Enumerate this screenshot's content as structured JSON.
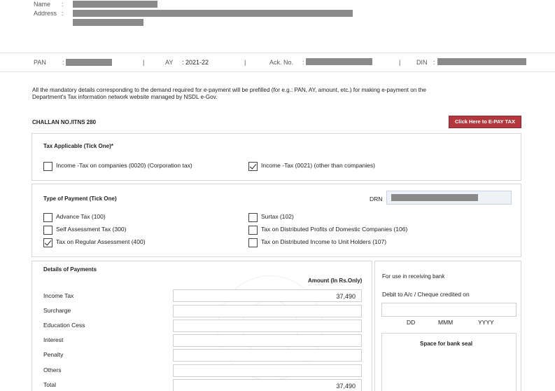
{
  "header": {
    "name_label": "Name",
    "address_label": "Address",
    "colon": ":"
  },
  "panbar": {
    "pan_label": "PAN",
    "ay_label": "AY",
    "ay_value": ": 2021-22",
    "ack_label": "Ack. No.",
    "din_label": "DIN",
    "separator": "|"
  },
  "intro": {
    "line1": "All the mandatory details corresponding to the demand required for e-payment will be prefilled (for e.g.: PAN, AY, amount, etc.) for making e-payment on the",
    "line2": "Department's Tax information network website managed by NSDL e-Gov."
  },
  "challan": {
    "title": "CHALLAN NO./ITNS 280",
    "pay_button": "Click Here to E-PAY TAX"
  },
  "tax_applicable": {
    "title": "Tax Applicable (Tick One)*",
    "options": [
      {
        "label": "Income -Tax on companies (0020) (Corporation tax)",
        "checked": false
      },
      {
        "label": "Income -Tax (0021) (other than companies)",
        "checked": true
      }
    ]
  },
  "payment_type": {
    "title": "Type of Payment (Tick One)",
    "drn_label": "DRN",
    "options": [
      {
        "label": "Advance Tax (100)",
        "checked": false
      },
      {
        "label": "Surtax (102)",
        "checked": false
      },
      {
        "label": "Self Assessment Tax (300)",
        "checked": false
      },
      {
        "label": "Tax on Distributed Profits of Domestic Companies (106)",
        "checked": false
      },
      {
        "label": "Tax on Regular Assessment (400)",
        "checked": true
      },
      {
        "label": "Tax on Distributed Income to Unit Holders (107)",
        "checked": false
      }
    ]
  },
  "details": {
    "title": "Details of Payments",
    "amount_header": "Amount (In Rs.Only)",
    "rows": [
      {
        "label": "Income Tax",
        "amount": "37,490"
      },
      {
        "label": "Surcharge",
        "amount": ""
      },
      {
        "label": "Education Cess",
        "amount": ""
      },
      {
        "label": "Interest",
        "amount": ""
      },
      {
        "label": "Penalty",
        "amount": ""
      },
      {
        "label": "Others",
        "amount": ""
      },
      {
        "label": "Total",
        "amount": "37,490"
      }
    ]
  },
  "bank": {
    "title": "For use in receiving bank",
    "debit_label": "Debit to A/c / Cheque credited on",
    "dd": "DD",
    "mmm": "MMM",
    "yyyy": "YYYY",
    "seal_label": "Space for bank seal"
  },
  "colors": {
    "button": "#b3383e",
    "redaction": "#8a8a8a",
    "border": "#d8d8d8"
  }
}
